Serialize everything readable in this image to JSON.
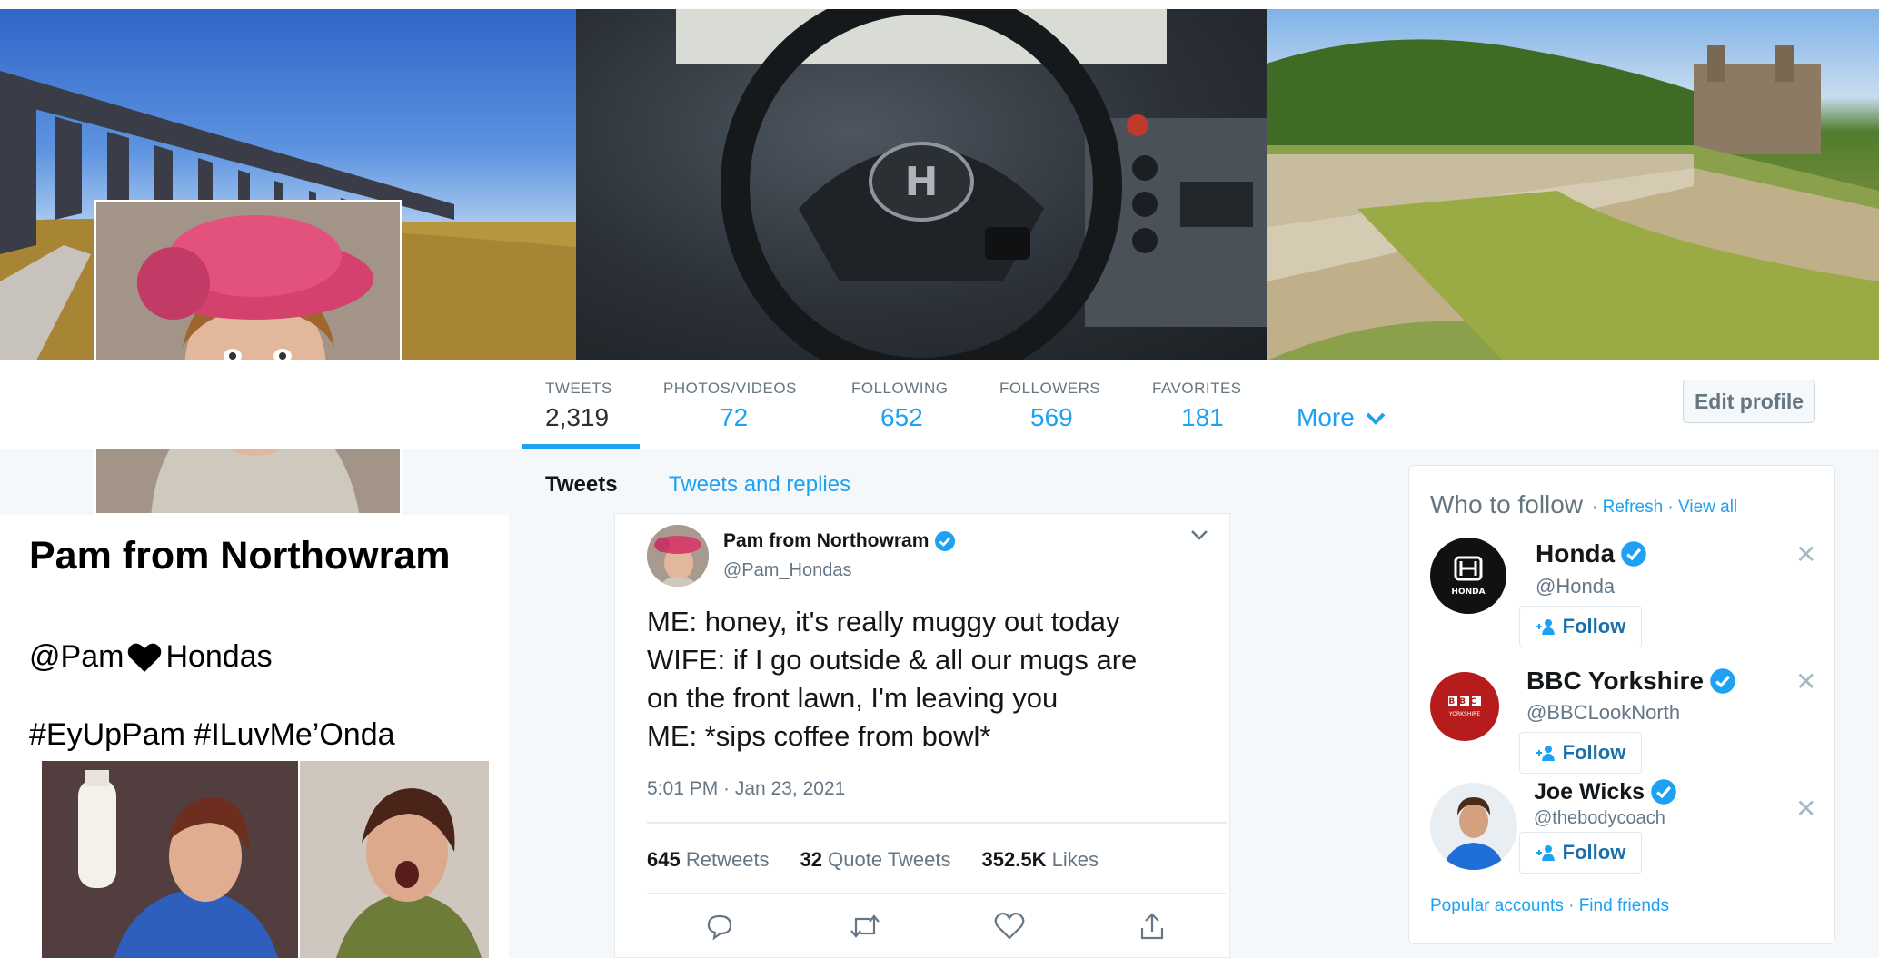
{
  "profile": {
    "name": "Pam from Northowram",
    "handle_prefix": "@Pam",
    "handle_suffix": "Hondas",
    "hashtags": "#EyUpPam #ILuvMe’Onda"
  },
  "nav": {
    "stats": [
      {
        "label": "TWEETS",
        "value": "2,319"
      },
      {
        "label": "PHOTOS/VIDEOS",
        "value": "72"
      },
      {
        "label": "FOLLOWING",
        "value": "652"
      },
      {
        "label": "FOLLOWERS",
        "value": "569"
      },
      {
        "label": "FAVORITES",
        "value": "181"
      }
    ],
    "more_label": "More",
    "edit_profile_label": "Edit profile"
  },
  "tabs": {
    "tweets": "Tweets",
    "replies": "Tweets and replies"
  },
  "tweet": {
    "author_name": "Pam from Northowram",
    "author_handle": "@Pam_Hondas",
    "lines": [
      "ME: honey, it's really muggy out today",
      "WIFE: if I go outside & all our mugs are",
      "on the front lawn, I'm leaving you",
      "ME: *sips coffee from bowl*"
    ],
    "timestamp": "5:01 PM · Jan 23, 2021",
    "retweets_count": "645",
    "retweets_label": "Retweets",
    "quotes_count": "32",
    "quotes_label": "Quote Tweets",
    "likes_count": "352.5K",
    "likes_label": "Likes"
  },
  "who_to_follow": {
    "title": "Who to follow",
    "links": "· Refresh · View all",
    "follow_label": "Follow",
    "footer": "Popular accounts · Find friends",
    "accounts": [
      {
        "name": "Honda",
        "handle": "@Honda",
        "logo_text": "HONDA"
      },
      {
        "name": "BBC Yorkshire",
        "handle": "@BBCLookNorth",
        "logo_text_1": "BBC",
        "logo_text_2": "YORKSHIRE"
      },
      {
        "name": "Joe Wicks",
        "handle": "@thebodycoach"
      }
    ]
  },
  "colors": {
    "accent": "#1da1f2",
    "verified": "#1da1f2",
    "text": "#14171a",
    "muted": "#657786"
  }
}
